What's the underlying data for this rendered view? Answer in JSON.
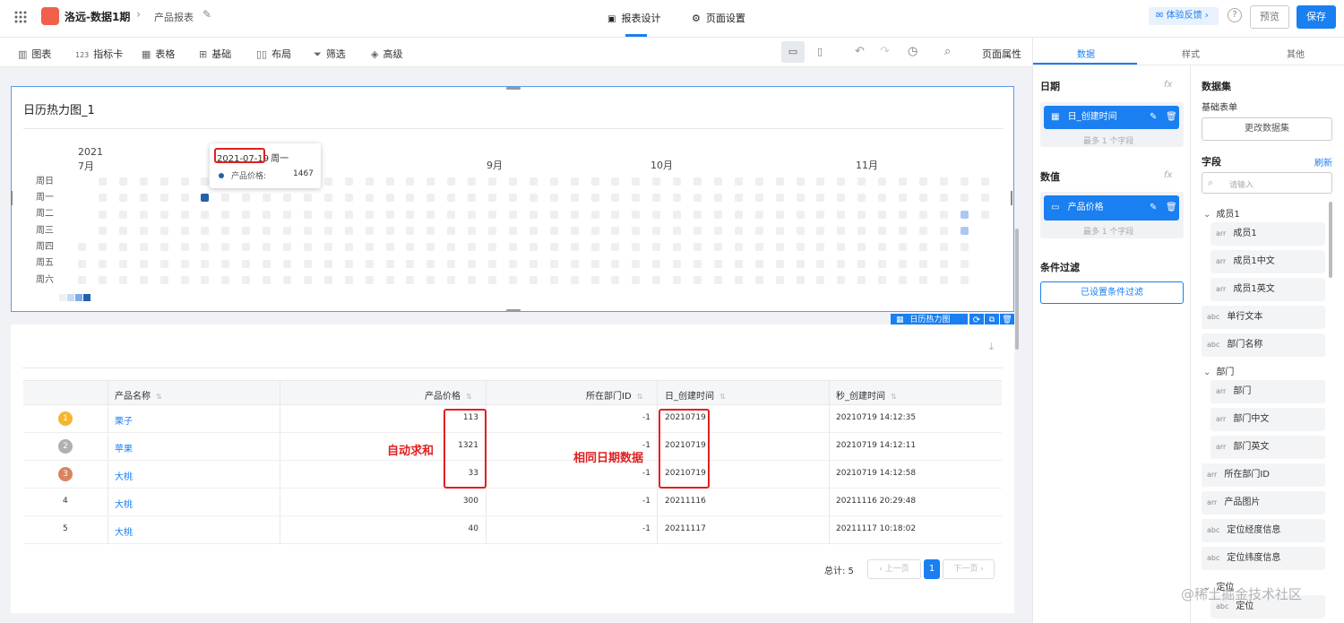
{
  "topbar": {
    "project": "洛远-数据1期",
    "page": "产品报表",
    "tabs": [
      "报表设计",
      "页面设置"
    ],
    "feedback": "体验反馈",
    "preview": "预览",
    "save": "保存"
  },
  "toolbar": {
    "items": [
      "图表",
      "指标卡",
      "表格",
      "基础",
      "布局",
      "筛选",
      "高级"
    ],
    "page_props": "页面属性"
  },
  "heatmap": {
    "title": "日历热力图_1",
    "year": "2021",
    "months": [
      "7月",
      "9月",
      "10月",
      "11月"
    ],
    "weekdays": [
      "周日",
      "周一",
      "周二",
      "周三",
      "周四",
      "周五",
      "周六"
    ],
    "tooltip": {
      "date": "2021-07-19",
      "weekday": "周一",
      "label": "产品价格:",
      "value": "1467"
    },
    "badge": "日历热力图"
  },
  "table": {
    "headers": [
      "产品名称",
      "产品价格",
      "所在部门ID",
      "日_创建时间",
      "秒_创建时间"
    ],
    "rows": [
      {
        "rank": "1",
        "name": "栗子",
        "price": "113",
        "dept": "-1",
        "day": "20210719",
        "sec": "20210719 14:12:35"
      },
      {
        "rank": "2",
        "name": "苹果",
        "price": "1321",
        "dept": "-1",
        "day": "20210719",
        "sec": "20210719 14:12:11"
      },
      {
        "rank": "3",
        "name": "大桃",
        "price": "33",
        "dept": "-1",
        "day": "20210719",
        "sec": "20210719 14:12:58"
      },
      {
        "rank": "4",
        "name": "大桃",
        "price": "300",
        "dept": "-1",
        "day": "20211116",
        "sec": "20211116 20:29:48"
      },
      {
        "rank": "5",
        "name": "大桃",
        "price": "40",
        "dept": "-1",
        "day": "20211117",
        "sec": "20211117 10:18:02"
      }
    ],
    "annotations": {
      "sum": "自动求和",
      "same_date": "相同日期数据"
    },
    "pagination": {
      "total": "总计: 5",
      "prev": "上一页",
      "page": "1",
      "next": "下一页"
    }
  },
  "panel": {
    "tabs": [
      "数据",
      "样式",
      "其他"
    ],
    "date_label": "日期",
    "date_field": "日_创建时间",
    "date_hint": "最多 1 个字段",
    "value_label": "数值",
    "value_field": "产品价格",
    "value_hint": "最多 1 个字段",
    "filter_label": "条件过滤",
    "filter_btn": "已设置条件过滤",
    "dataset_label": "数据集",
    "dataset_name": "基础表单",
    "change_dataset": "更改数据集",
    "fields_label": "字段",
    "refresh": "刷新",
    "search_placeholder": "请输入",
    "groups": [
      {
        "name": "成员1",
        "items": [
          {
            "type": "arr",
            "name": "成员1"
          },
          {
            "type": "arr",
            "name": "成员1中文"
          },
          {
            "type": "arr",
            "name": "成员1英文"
          }
        ]
      },
      {
        "name": "部门",
        "items": [
          {
            "type": "arr",
            "name": "部门"
          },
          {
            "type": "arr",
            "name": "部门中文"
          },
          {
            "type": "arr",
            "name": "部门英文"
          }
        ]
      },
      {
        "name": "定位",
        "items": [
          {
            "type": "abc",
            "name": "定位"
          }
        ]
      }
    ],
    "singles_a": [
      {
        "type": "abc",
        "name": "单行文本"
      },
      {
        "type": "abc",
        "name": "部门名称"
      }
    ],
    "singles_b": [
      {
        "type": "arr",
        "name": "所在部门ID"
      },
      {
        "type": "arr",
        "name": "产品图片"
      },
      {
        "type": "abc",
        "name": "定位经度信息"
      },
      {
        "type": "abc",
        "name": "定位纬度信息"
      }
    ]
  },
  "watermark": "@稀土掘金技术社区",
  "colors": {
    "accent": "#1a7ff0",
    "redbox": "#e02020",
    "heat_dark": "#2560a8",
    "heat_light": "#a9c8f0"
  }
}
